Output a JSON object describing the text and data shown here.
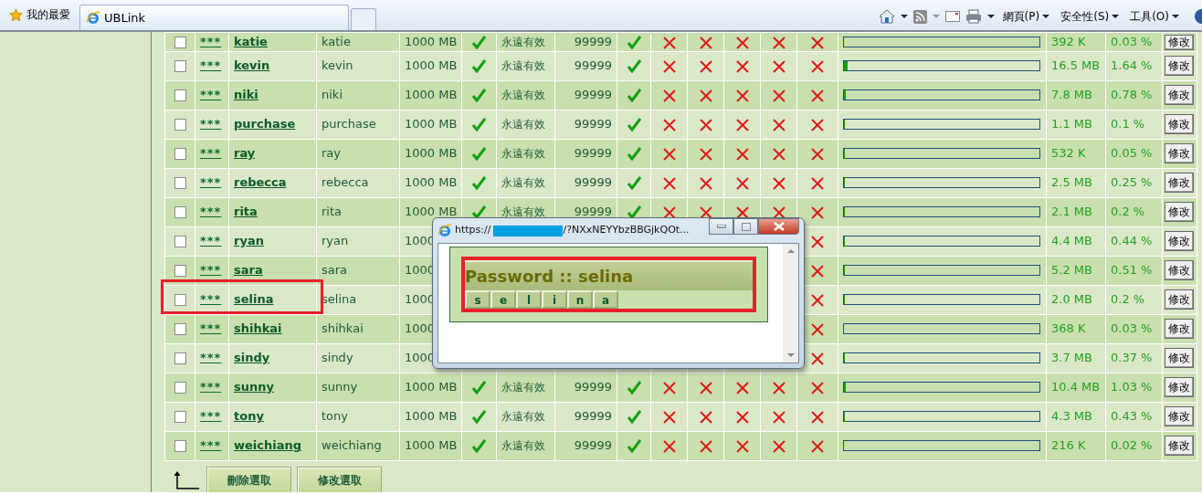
{
  "toolbar": {
    "favorites": "我的最愛",
    "tabs": [
      {
        "label": "UBLink",
        "selected": true
      }
    ],
    "menus": [
      "網頁(P)",
      "安全性(S)",
      "工具(O)"
    ]
  },
  "rows": [
    {
      "checked": false,
      "password": "***",
      "username": "katie",
      "name": "katie",
      "quota": "1000 MB",
      "active": true,
      "expiry": "永遠有效",
      "limit": "99999",
      "mail": true,
      "flag_1": false,
      "flag_2": false,
      "flag_3": false,
      "flag_4": false,
      "flag_5": false,
      "level": 0.0003,
      "size": "392 K",
      "percent": "0.03 %",
      "action": "修改",
      "highlighted": false
    },
    {
      "checked": false,
      "password": "***",
      "username": "kevin",
      "name": "kevin",
      "quota": "1000 MB",
      "active": true,
      "expiry": "永遠有效",
      "limit": "99999",
      "mail": true,
      "flag_1": false,
      "flag_2": false,
      "flag_3": false,
      "flag_4": false,
      "flag_5": false,
      "level": 0.0164,
      "size": "16.5 MB",
      "percent": "1.64 %",
      "action": "修改",
      "highlighted": false
    },
    {
      "checked": false,
      "password": "***",
      "username": "niki",
      "name": "niki",
      "quota": "1000 MB",
      "active": true,
      "expiry": "永遠有效",
      "limit": "99999",
      "mail": true,
      "flag_1": false,
      "flag_2": false,
      "flag_3": false,
      "flag_4": false,
      "flag_5": false,
      "level": 0.0078,
      "size": "7.8 MB",
      "percent": "0.78 %",
      "action": "修改",
      "highlighted": false
    },
    {
      "checked": false,
      "password": "***",
      "username": "purchase",
      "name": "purchase",
      "quota": "1000 MB",
      "active": true,
      "expiry": "永遠有效",
      "limit": "99999",
      "mail": true,
      "flag_1": false,
      "flag_2": false,
      "flag_3": false,
      "flag_4": false,
      "flag_5": false,
      "level": 0.001,
      "size": "1.1 MB",
      "percent": "0.1 %",
      "action": "修改",
      "highlighted": false
    },
    {
      "checked": false,
      "password": "***",
      "username": "ray",
      "name": "ray",
      "quota": "1000 MB",
      "active": true,
      "expiry": "永遠有效",
      "limit": "99999",
      "mail": true,
      "flag_1": false,
      "flag_2": false,
      "flag_3": false,
      "flag_4": false,
      "flag_5": false,
      "level": 0.0005,
      "size": "532 K",
      "percent": "0.05 %",
      "action": "修改",
      "highlighted": false
    },
    {
      "checked": false,
      "password": "***",
      "username": "rebecca",
      "name": "rebecca",
      "quota": "1000 MB",
      "active": true,
      "expiry": "永遠有效",
      "limit": "99999",
      "mail": true,
      "flag_1": false,
      "flag_2": false,
      "flag_3": false,
      "flag_4": false,
      "flag_5": false,
      "level": 0.0025,
      "size": "2.5 MB",
      "percent": "0.25 %",
      "action": "修改",
      "highlighted": false
    },
    {
      "checked": false,
      "password": "***",
      "username": "rita",
      "name": "rita",
      "quota": "1000 MB",
      "active": true,
      "expiry": "永遠有效",
      "limit": "99999",
      "mail": true,
      "flag_1": false,
      "flag_2": false,
      "flag_3": false,
      "flag_4": false,
      "flag_5": false,
      "level": 0.002,
      "size": "2.1 MB",
      "percent": "0.2 %",
      "action": "修改",
      "highlighted": false
    },
    {
      "checked": false,
      "password": "***",
      "username": "ryan",
      "name": "ryan",
      "quota": "1000",
      "flag_5": false,
      "level": 0.0044,
      "size": "4.4 MB",
      "percent": "0.44 %",
      "action": "修改",
      "highlighted": false
    },
    {
      "checked": false,
      "password": "***",
      "username": "sara",
      "name": "sara",
      "quota": "1000",
      "flag_5": false,
      "level": 0.0051,
      "size": "5.2 MB",
      "percent": "0.51 %",
      "action": "修改",
      "highlighted": false
    },
    {
      "checked": false,
      "password": "***",
      "username": "selina",
      "name": "selina",
      "quota": "1000",
      "flag_5": false,
      "level": 0.002,
      "size": "2.0 MB",
      "percent": "0.2 %",
      "action": "修改",
      "highlighted": true
    },
    {
      "checked": false,
      "password": "***",
      "username": "shihkai",
      "name": "shihkai",
      "quota": "1000",
      "flag_5": false,
      "level": 0.0003,
      "size": "368 K",
      "percent": "0.03 %",
      "action": "修改",
      "highlighted": false
    },
    {
      "checked": false,
      "password": "***",
      "username": "sindy",
      "name": "sindy",
      "quota": "1000",
      "flag_5": false,
      "level": 0.0037,
      "size": "3.7 MB",
      "percent": "0.37 %",
      "action": "修改",
      "highlighted": false
    },
    {
      "checked": false,
      "password": "***",
      "username": "sunny",
      "name": "sunny",
      "quota": "1000 MB",
      "active": true,
      "expiry": "永遠有效",
      "limit": "99999",
      "mail": true,
      "flag_1": false,
      "flag_2": false,
      "flag_3": false,
      "flag_4": false,
      "flag_5": false,
      "level": 0.0103,
      "size": "10.4 MB",
      "percent": "1.03 %",
      "action": "修改",
      "highlighted": false
    },
    {
      "checked": false,
      "password": "***",
      "username": "tony",
      "name": "tony",
      "quota": "1000 MB",
      "active": true,
      "expiry": "永遠有效",
      "limit": "99999",
      "mail": true,
      "flag_1": false,
      "flag_2": false,
      "flag_3": false,
      "flag_4": false,
      "flag_5": false,
      "level": 0.0043,
      "size": "4.3 MB",
      "percent": "0.43 %",
      "action": "修改",
      "highlighted": false
    },
    {
      "checked": false,
      "password": "***",
      "username": "weichiang",
      "name": "weichiang",
      "quota": "1000 MB",
      "active": true,
      "expiry": "永遠有效",
      "limit": "99999",
      "mail": true,
      "flag_1": false,
      "flag_2": false,
      "flag_3": false,
      "flag_4": false,
      "flag_5": false,
      "level": 0.0002,
      "size": "216 K",
      "percent": "0.02 %",
      "action": "修改",
      "highlighted": false
    }
  ],
  "footer_buttons": [
    "刪除選取",
    "修改選取"
  ],
  "popup": {
    "url_prefix": "https://",
    "url_suffix": "/?NXxNEYYbzBBGjkQOt...",
    "heading": "Password :: selina",
    "characters": [
      "s",
      "e",
      "l",
      "i",
      "n",
      "a"
    ],
    "highlighted": true
  }
}
